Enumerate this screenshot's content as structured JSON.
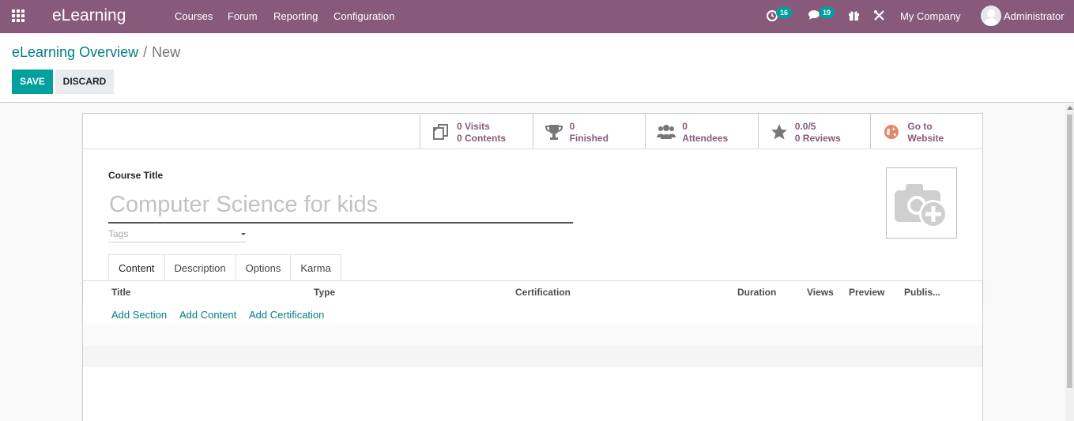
{
  "navbar": {
    "app_name": "eLearning",
    "menus": [
      "Courses",
      "Forum",
      "Reporting",
      "Configuration"
    ],
    "activity_count": "16",
    "message_count": "19",
    "company": "My Company",
    "user": "Administrator",
    "bar_color": "#875a7b"
  },
  "breadcrumb": {
    "parent": "eLearning Overview",
    "separator": "/",
    "current": "New"
  },
  "actions": {
    "save_label": "SAVE",
    "discard_label": "DISCARD"
  },
  "stats": [
    {
      "icon": "files-icon",
      "line1": "0 Visits",
      "line2": "0 Contents"
    },
    {
      "icon": "trophy-icon",
      "line1": "0",
      "line2": "Finished"
    },
    {
      "icon": "users-icon",
      "line1": "0",
      "line2": "Attendees"
    },
    {
      "icon": "star-icon",
      "line1": "0.0/5",
      "line2": "0 Reviews"
    },
    {
      "icon": "globe-icon",
      "line1": "Go to",
      "line2": "Website"
    }
  ],
  "form": {
    "title_label": "Course Title",
    "title_placeholder": "Computer Science for kids",
    "title_value": "",
    "tags_placeholder": "Tags"
  },
  "tabs": [
    {
      "label": "Content",
      "active": true
    },
    {
      "label": "Description",
      "active": false
    },
    {
      "label": "Options",
      "active": false
    },
    {
      "label": "Karma",
      "active": false
    }
  ],
  "table": {
    "columns": [
      "Title",
      "Type",
      "Certification",
      "Duration",
      "Views",
      "Preview",
      "Publis..."
    ],
    "add_links": [
      "Add Section",
      "Add Content",
      "Add Certification"
    ]
  },
  "colors": {
    "primary": "#00a09d",
    "link": "#017e84",
    "brand": "#875a7b"
  }
}
